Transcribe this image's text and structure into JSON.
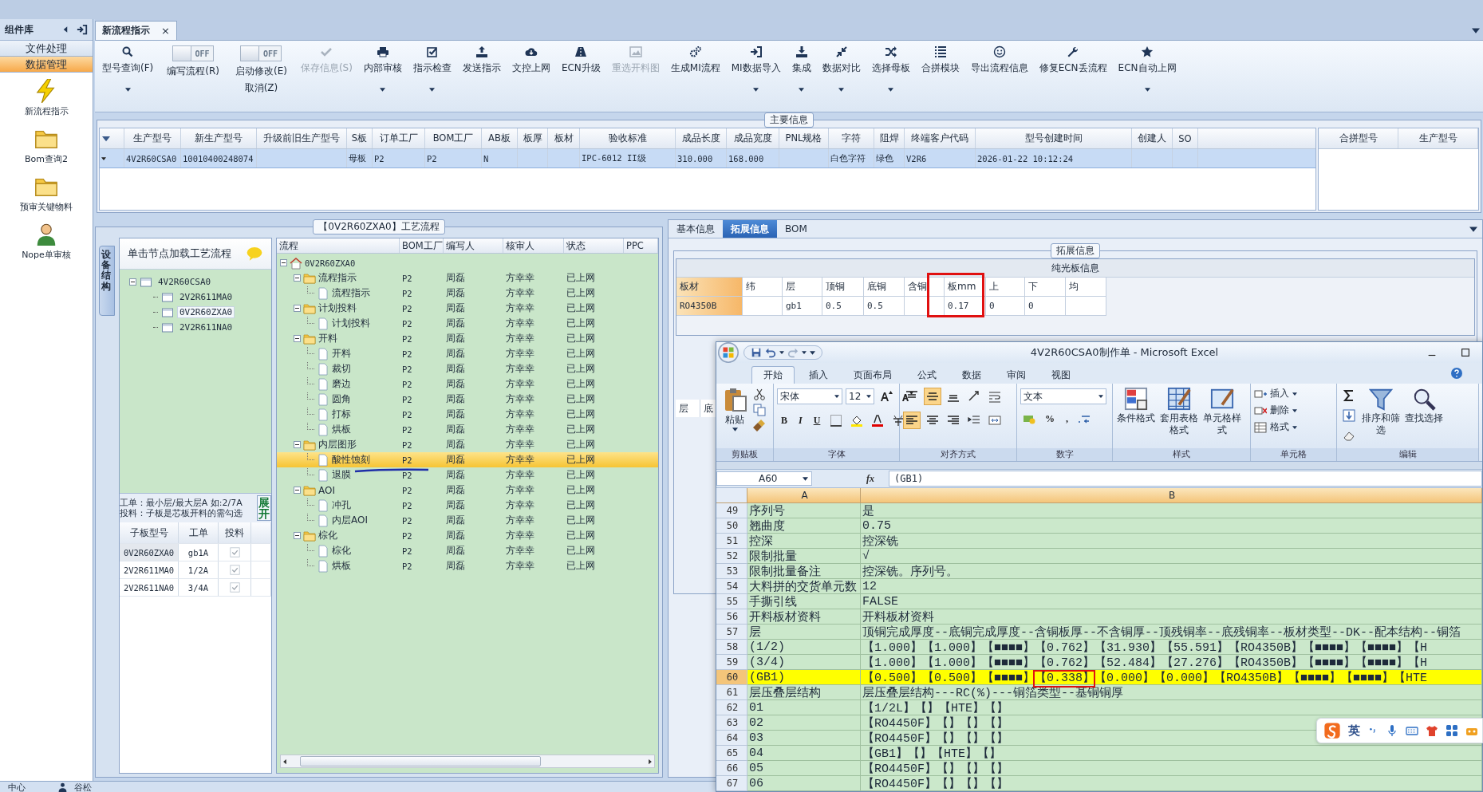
{
  "sidebar": {
    "title": "组件库",
    "sections": [
      {
        "label": "文件处理",
        "selected": false
      },
      {
        "label": "数据管理",
        "selected": true
      }
    ],
    "items": [
      {
        "label": "新流程指示"
      },
      {
        "label": "Bom查询2"
      },
      {
        "label": "预审关键物料"
      },
      {
        "label": "Nope单审核"
      }
    ]
  },
  "document_tab": {
    "label": "新流程指示",
    "close": "×"
  },
  "toolbar": [
    {
      "kind": "button",
      "label": "型号查询(F)",
      "dropdown": true,
      "disabled": false
    },
    {
      "kind": "toggle",
      "label": "编写流程(R)",
      "switch_text": "OFF",
      "on": false
    },
    {
      "kind": "toggle",
      "label": "启动修改(E)",
      "sublabel": "取消(Z)",
      "switch_text": "OFF",
      "on": false
    },
    {
      "kind": "button",
      "label": "保存信息(S)",
      "dropdown": false,
      "disabled": true
    },
    {
      "kind": "button",
      "label": "内部审核",
      "dropdown": true,
      "disabled": false
    },
    {
      "kind": "button",
      "label": "指示检查",
      "dropdown": true,
      "disabled": false
    },
    {
      "kind": "button",
      "label": "发送指示",
      "dropdown": false,
      "disabled": false
    },
    {
      "kind": "button",
      "label": "文控上网",
      "dropdown": false,
      "disabled": false
    },
    {
      "kind": "button",
      "label": "ECN升级",
      "dropdown": false,
      "disabled": false
    },
    {
      "kind": "button",
      "label": "重选开料图",
      "dropdown": false,
      "disabled": true
    },
    {
      "kind": "button",
      "label": "生成MI流程",
      "dropdown": false,
      "disabled": false
    },
    {
      "kind": "button",
      "label": "MI数据导入",
      "dropdown": true,
      "disabled": false
    },
    {
      "kind": "button",
      "label": "集成",
      "dropdown": true,
      "disabled": false
    },
    {
      "kind": "button",
      "label": "数据对比",
      "dropdown": true,
      "disabled": false
    },
    {
      "kind": "button",
      "label": "选择母板",
      "dropdown": true,
      "disabled": false
    },
    {
      "kind": "button",
      "label": "合拼模块",
      "dropdown": false,
      "disabled": false
    },
    {
      "kind": "button",
      "label": "导出流程信息",
      "dropdown": false,
      "disabled": false
    },
    {
      "kind": "button",
      "label": "修复ECN丢流程",
      "dropdown": false,
      "disabled": false
    },
    {
      "kind": "button",
      "label": "ECN自动上网",
      "dropdown": true,
      "disabled": false
    }
  ],
  "main_info": {
    "title": "主要信息",
    "columns": [
      "生产型号",
      "新生产型号",
      "升级前旧生产型号",
      "S板",
      "订单工厂",
      "BOM工厂",
      "AB板",
      "板厚",
      "板材",
      "验收标准",
      "成品长度",
      "成品宽度",
      "PNL规格",
      "字符",
      "阻焊",
      "终端客户代码",
      "型号创建时间",
      "创建人",
      "SO"
    ],
    "rows": [
      {
        "selected": true,
        "cells": [
          "4V2R60CSA0",
          "10010400248074",
          null,
          "母板",
          "P2",
          "P2",
          "N",
          null,
          null,
          "IPC-6012 II级",
          "310.000",
          "168.000",
          null,
          "白色字符",
          "绿色",
          "V2R6",
          "2026-01-22 10:12:24",
          null,
          null
        ]
      }
    ],
    "merge_columns": [
      "合拼型号",
      "生产型号"
    ]
  },
  "process_panel": {
    "title": "【0V2R60ZXA0】工艺流程",
    "side_tab": "设备结构",
    "tree_header": "单击节点加载工艺流程",
    "structure": [
      {
        "label": "4V2R60CSA0",
        "expanded": true,
        "selected": false,
        "children": [
          {
            "label": "2V2R611MA0",
            "selected": false
          },
          {
            "label": "0V2R60ZXA0",
            "selected": true
          },
          {
            "label": "2V2R611NA0",
            "selected": false
          }
        ]
      }
    ],
    "notes": [
      "工单：最小层/最大层A 如:2/7A",
      "投料：子板是芯板开料的需勾选"
    ],
    "expand_button": "展开",
    "sub_boards": {
      "columns": [
        "子板型号",
        "工单",
        "投料"
      ],
      "rows": [
        {
          "board": "0V2R60ZXA0",
          "order": "gb1A",
          "checked": true,
          "selected": true
        },
        {
          "board": "2V2R611MA0",
          "order": "1/2A",
          "checked": true,
          "selected": false
        },
        {
          "board": "2V2R611NA0",
          "order": "3/4A",
          "checked": true,
          "selected": false
        }
      ]
    },
    "flow": {
      "columns": [
        "流程",
        "BOM工厂",
        "编写人",
        "核审人",
        "状态",
        "PPC"
      ],
      "root": {
        "label": "0V2R60ZXA0",
        "expanded": true,
        "selected": false,
        "children": [
          {
            "label": "流程指示",
            "bom": "P2",
            "writer": "周磊",
            "reviewer": "方幸幸",
            "status": "已上网",
            "expanded": true,
            "selected": false,
            "children": [
              {
                "label": "流程指示",
                "bom": "P2",
                "writer": "周磊",
                "reviewer": "方幸幸",
                "status": "已上网",
                "selected": false
              }
            ]
          },
          {
            "label": "计划投料",
            "bom": "P2",
            "writer": "周磊",
            "reviewer": "方幸幸",
            "status": "已上网",
            "expanded": true,
            "selected": false,
            "children": [
              {
                "label": "计划投料",
                "bom": "P2",
                "writer": "周磊",
                "reviewer": "方幸幸",
                "status": "已上网",
                "selected": false
              }
            ]
          },
          {
            "label": "开料",
            "bom": "P2",
            "writer": "周磊",
            "reviewer": "方幸幸",
            "status": "已上网",
            "expanded": true,
            "selected": false,
            "children": [
              {
                "label": "开料",
                "bom": "P2",
                "writer": "周磊",
                "reviewer": "方幸幸",
                "status": "已上网",
                "selected": false
              },
              {
                "label": "裁切",
                "bom": "P2",
                "writer": "周磊",
                "reviewer": "方幸幸",
                "status": "已上网",
                "selected": false
              },
              {
                "label": "磨边",
                "bom": "P2",
                "writer": "周磊",
                "reviewer": "方幸幸",
                "status": "已上网",
                "selected": false
              },
              {
                "label": "圆角",
                "bom": "P2",
                "writer": "周磊",
                "reviewer": "方幸幸",
                "status": "已上网",
                "selected": false
              },
              {
                "label": "打标",
                "bom": "P2",
                "writer": "周磊",
                "reviewer": "方幸幸",
                "status": "已上网",
                "selected": false
              },
              {
                "label": "烘板",
                "bom": "P2",
                "writer": "周磊",
                "reviewer": "方幸幸",
                "status": "已上网",
                "selected": false
              }
            ]
          },
          {
            "label": "内层图形",
            "bom": "P2",
            "writer": "周磊",
            "reviewer": "方幸幸",
            "status": "已上网",
            "expanded": true,
            "selected": false,
            "children": [
              {
                "label": "酸性蚀刻",
                "bom": "P2",
                "writer": "周磊",
                "reviewer": "方幸幸",
                "status": "已上网",
                "selected": true
              },
              {
                "label": "退膜",
                "bom": "P2",
                "writer": "周磊",
                "reviewer": "方幸幸",
                "status": "已上网",
                "selected": false
              }
            ]
          },
          {
            "label": "AOI",
            "bom": "P2",
            "writer": "周磊",
            "reviewer": "方幸幸",
            "status": "已上网",
            "expanded": true,
            "selected": false,
            "children": [
              {
                "label": "冲孔",
                "bom": "P2",
                "writer": "周磊",
                "reviewer": "方幸幸",
                "status": "已上网",
                "selected": false
              },
              {
                "label": "内层AOI",
                "bom": "P2",
                "writer": "周磊",
                "reviewer": "方幸幸",
                "status": "已上网",
                "selected": false
              }
            ]
          },
          {
            "label": "棕化",
            "bom": "P2",
            "writer": "周磊",
            "reviewer": "方幸幸",
            "status": "已上网",
            "expanded": true,
            "selected": false,
            "children": [
              {
                "label": "棕化",
                "bom": "P2",
                "writer": "周磊",
                "reviewer": "方幸幸",
                "status": "已上网",
                "selected": false
              },
              {
                "label": "烘板",
                "bom": "P2",
                "writer": "周磊",
                "reviewer": "方幸幸",
                "status": "已上网",
                "selected": false
              }
            ]
          }
        ]
      }
    }
  },
  "detail_panel": {
    "tabs": [
      {
        "label": "基本信息",
        "selected": false
      },
      {
        "label": "拓展信息",
        "selected": true
      },
      {
        "label": "BOM",
        "selected": false
      }
    ],
    "group_title": "拓展信息",
    "table_title": "纯光板信息",
    "columns": [
      "板材",
      "纬",
      "层",
      "顶铜",
      "底铜",
      "含铜",
      "板mm",
      "上",
      "下",
      "均"
    ],
    "rows": [
      {
        "cells": [
          "RO4350B",
          null,
          "gb1",
          "0.5",
          "0.5",
          null,
          "0.17",
          "0",
          "0",
          null
        ]
      }
    ],
    "lower_columns": [
      "层",
      "底"
    ]
  },
  "excel": {
    "title": "4V2R60CSA0制作单 - Microsoft Excel",
    "ribbon_tabs": [
      {
        "label": "开始",
        "selected": true
      },
      {
        "label": "插入",
        "selected": false
      },
      {
        "label": "页面布局",
        "selected": false
      },
      {
        "label": "公式",
        "selected": false
      },
      {
        "label": "数据",
        "selected": false
      },
      {
        "label": "审阅",
        "selected": false
      },
      {
        "label": "视图",
        "selected": false
      }
    ],
    "paste": "粘贴",
    "font_name": "宋体",
    "font_size": "12",
    "font_buttons": [
      "B",
      "I",
      "U"
    ],
    "number_format": "文本",
    "number_buttons": [
      "%",
      ","
    ],
    "styles": [
      "条件格式",
      "套用表格格式",
      "单元格样式"
    ],
    "cell_actions": [
      "插入",
      "删除",
      "格式"
    ],
    "editing": [
      "排序和筛选",
      "查找选择"
    ],
    "group_labels": [
      "剪贴板",
      "字体",
      "对齐方式",
      "数字",
      "样式",
      "单元格",
      "编辑"
    ],
    "name_box": "A60",
    "function_label": "fx",
    "formula": "(GB1)",
    "columns": [
      "A",
      "B"
    ],
    "rows": [
      {
        "number": "49",
        "a": "序列号",
        "b": "是",
        "selected": false
      },
      {
        "number": "50",
        "a": "翘曲度",
        "b": "0.75",
        "selected": false
      },
      {
        "number": "51",
        "a": "控深",
        "b": "控深铣",
        "selected": false
      },
      {
        "number": "52",
        "a": "限制批量",
        "b": "√",
        "selected": false
      },
      {
        "number": "53",
        "a": "限制批量备注",
        "b": "控深铣。序列号。",
        "selected": false
      },
      {
        "number": "54",
        "a": "大料拼的交货单元数",
        "b": "12",
        "selected": false
      },
      {
        "number": "55",
        "a": "手撕引线",
        "b": "FALSE",
        "selected": false
      },
      {
        "number": "56",
        "a": "开料板材资料",
        "b": "开料板材资料",
        "selected": false
      },
      {
        "number": "57",
        "a": "层",
        "b": "顶铜完成厚度--底铜完成厚度--含铜板厚--不含铜厚--顶残铜率--底残铜率--板材类型--DK--配本结构--铜箔",
        "selected": false
      },
      {
        "number": "58",
        "a": "(1/2)",
        "b": "【1.000】【1.000】【■■■■】【0.762】【31.930】【55.591】【RO4350B】【■■■■】【■■■■】【H",
        "selected": false
      },
      {
        "number": "59",
        "a": "(3/4)",
        "b": "【1.000】【1.000】【■■■■】【0.762】【52.484】【27.276】【RO4350B】【■■■■】【■■■■】【H",
        "selected": false
      },
      {
        "number": "60",
        "a": "(GB1)",
        "b": "【0.500】【0.500】【■■■■】【0.338】【0.000】【0.000】【RO4350B】【■■■■】【■■■■】【HTE",
        "selected": true
      },
      {
        "number": "61",
        "a": "层压叠层结构",
        "b": "层压叠层结构---RC(%)---铜箔类型--基铜铜厚",
        "selected": false
      },
      {
        "number": "62",
        "a": "01",
        "b": "【1/2L】【】【HTE】【】",
        "selected": false
      },
      {
        "number": "63",
        "a": "02",
        "b": "【RO4450F】【】【】【】",
        "selected": false
      },
      {
        "number": "64",
        "a": "03",
        "b": "【RO4450F】【】【】【】",
        "selected": false
      },
      {
        "number": "65",
        "a": "04",
        "b": "【GB1】【】【HTE】【】",
        "selected": false
      },
      {
        "number": "66",
        "a": "05",
        "b": "【RO4450F】【】【】【】",
        "selected": false
      },
      {
        "number": "67",
        "a": "06",
        "b": "【RO4450F】【】【】【】",
        "selected": false
      }
    ]
  },
  "ime_bar": {
    "mode": "英"
  },
  "status_bar": [
    "中心",
    "谷松"
  ]
}
